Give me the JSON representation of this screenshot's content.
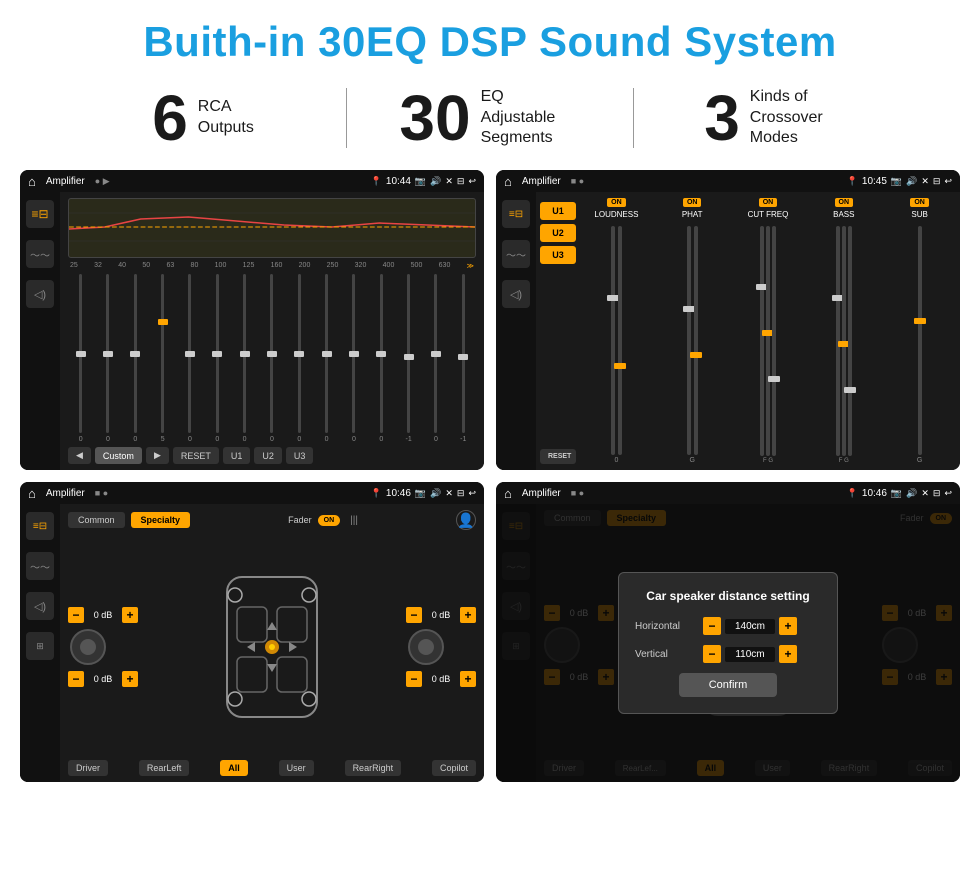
{
  "page": {
    "title": "Buith-in 30EQ DSP Sound System",
    "stats": [
      {
        "number": "6",
        "label": "RCA\nOutputs"
      },
      {
        "number": "30",
        "label": "EQ Adjustable\nSegments"
      },
      {
        "number": "3",
        "label": "Kinds of\nCrossover Modes"
      }
    ]
  },
  "screen1": {
    "title": "Amplifier",
    "time": "10:44",
    "frequencies": [
      "25",
      "32",
      "40",
      "50",
      "63",
      "80",
      "100",
      "125",
      "160",
      "200",
      "250",
      "320",
      "400",
      "500",
      "630"
    ],
    "values": [
      "0",
      "0",
      "0",
      "5",
      "0",
      "0",
      "0",
      "0",
      "0",
      "0",
      "0",
      "0",
      "0",
      "-1",
      "0",
      "-1"
    ],
    "buttons": [
      "Custom",
      "RESET",
      "U1",
      "U2",
      "U3"
    ]
  },
  "screen2": {
    "title": "Amplifier",
    "time": "10:45",
    "presets": [
      "U1",
      "U2",
      "U3"
    ],
    "channels": [
      {
        "label": "LOUDNESS",
        "on": true
      },
      {
        "label": "PHAT",
        "on": true
      },
      {
        "label": "CUT FREQ",
        "on": true
      },
      {
        "label": "BASS",
        "on": true
      },
      {
        "label": "SUB",
        "on": true
      }
    ],
    "reset_label": "RESET"
  },
  "screen3": {
    "title": "Amplifier",
    "time": "10:46",
    "tabs": [
      "Common",
      "Specialty"
    ],
    "active_tab": "Specialty",
    "fader_label": "Fader",
    "fader_on": "ON",
    "volumes": [
      {
        "value": "0 dB",
        "pos": "tl"
      },
      {
        "value": "0 dB",
        "pos": "tr"
      },
      {
        "value": "0 dB",
        "pos": "bl"
      },
      {
        "value": "0 dB",
        "pos": "br"
      }
    ],
    "buttons": [
      "Driver",
      "RearLeft",
      "All",
      "User",
      "RearRight",
      "Copilot"
    ]
  },
  "screen4": {
    "title": "Amplifier",
    "time": "10:46",
    "tabs": [
      "Common",
      "Specialty"
    ],
    "dialog": {
      "title": "Car speaker distance setting",
      "rows": [
        {
          "label": "Horizontal",
          "value": "140cm"
        },
        {
          "label": "Vertical",
          "value": "110cm"
        }
      ],
      "confirm_label": "Confirm"
    },
    "volumes": [
      {
        "value": "0 dB"
      },
      {
        "value": "0 dB"
      }
    ],
    "buttons": [
      "Driver",
      "RearLef...",
      "All",
      "User",
      "RearRight",
      "Copilot"
    ]
  }
}
